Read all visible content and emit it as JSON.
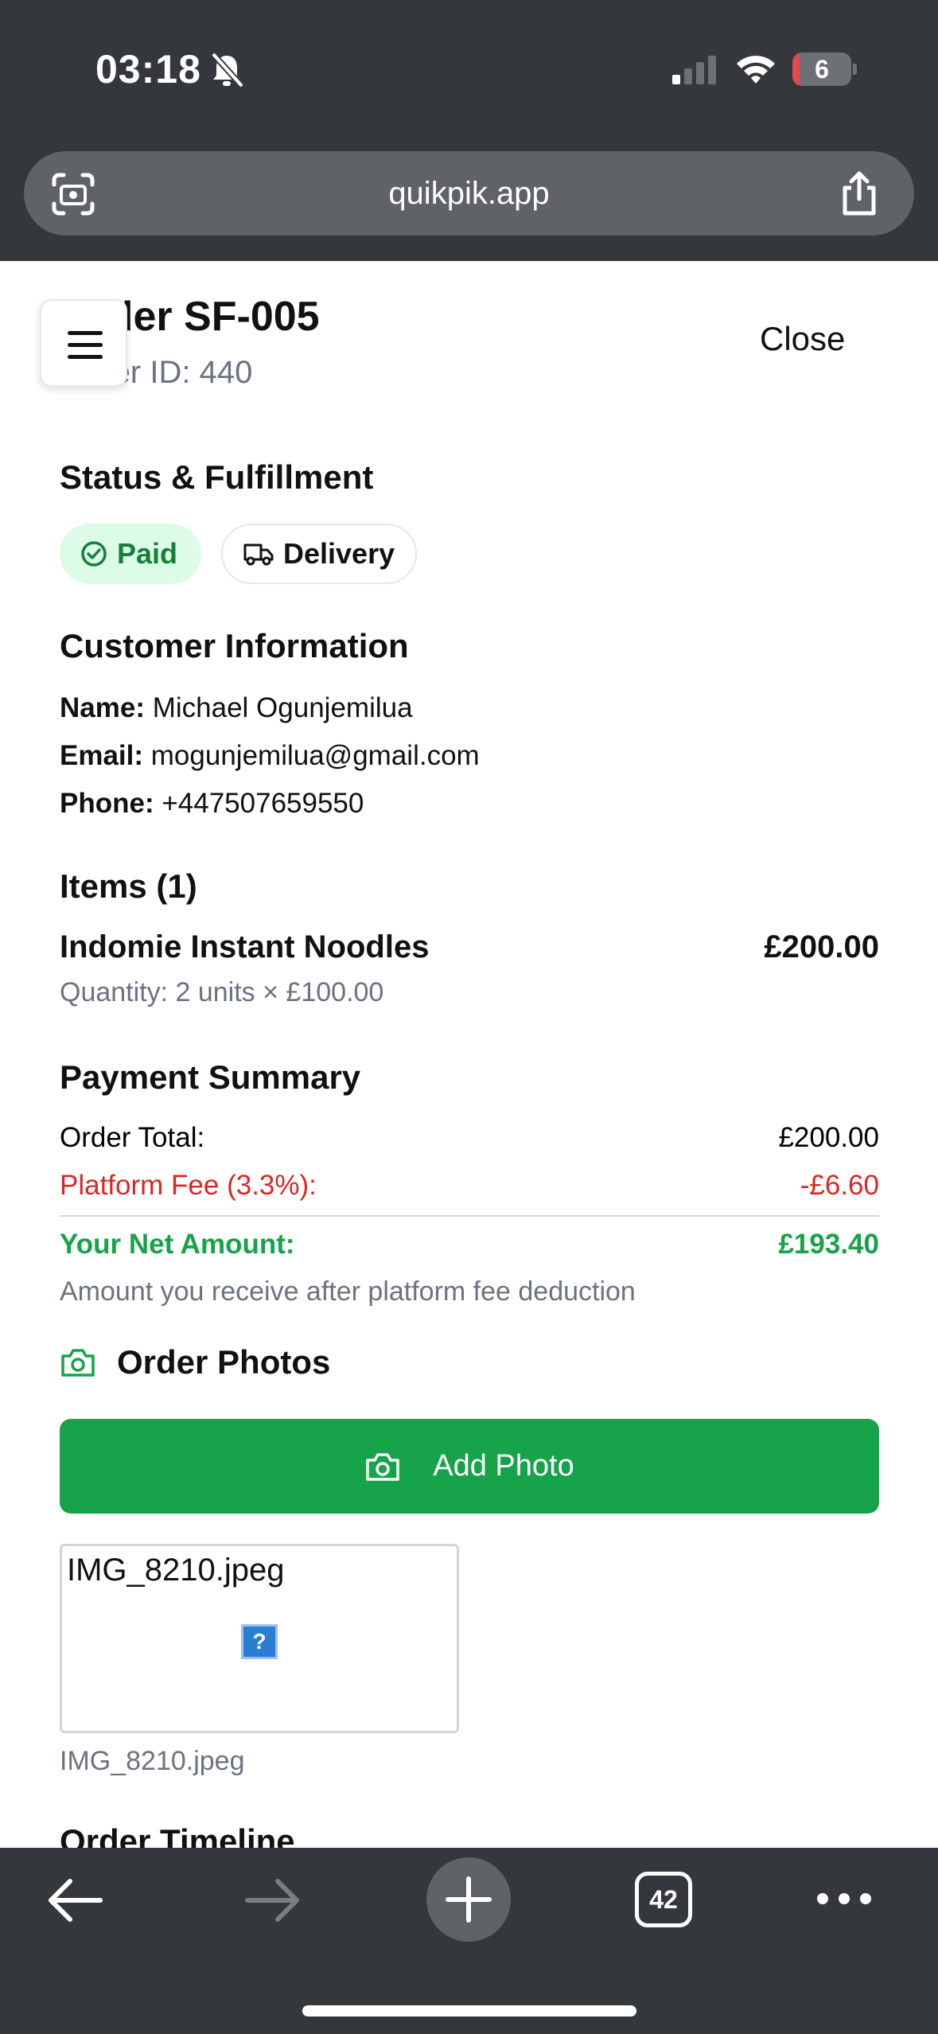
{
  "status_bar": {
    "time": "03:18",
    "battery": "6",
    "icons": [
      "bell-slash-icon",
      "cellular-signal-icon",
      "wifi-icon",
      "battery-icon"
    ]
  },
  "browser": {
    "url": "quikpik.app",
    "tab_count": "42"
  },
  "header": {
    "title": "Order SF-005",
    "order_id": "Order ID: 440",
    "close_label": "Close"
  },
  "status_section": {
    "heading": "Status & Fulfillment",
    "payment_badge": "Paid",
    "fulfillment_badge": "Delivery"
  },
  "customer": {
    "heading": "Customer Information",
    "name_label": "Name:",
    "name": "Michael Ogunjemilua",
    "email_label": "Email:",
    "email": "mogunjemilua@gmail.com",
    "phone_label": "Phone:",
    "phone": "+447507659550"
  },
  "items": {
    "heading": "Items (1)",
    "list": [
      {
        "name": "Indomie Instant Noodles",
        "price": "£200.00",
        "quantity": "Quantity: 2 units × £100.00"
      }
    ]
  },
  "payment": {
    "heading": "Payment Summary",
    "order_total_label": "Order Total:",
    "order_total": "£200.00",
    "fee_label": "Platform Fee (3.3%):",
    "fee": "-£6.60",
    "net_label": "Your Net Amount:",
    "net": "£193.40",
    "note": "Amount you receive after platform fee deduction"
  },
  "photos": {
    "heading": "Order Photos",
    "add_label": "Add Photo",
    "images": [
      {
        "alt": "IMG_8210.jpeg",
        "filename": "IMG_8210.jpeg",
        "placeholder": "?"
      }
    ]
  },
  "timeline": {
    "heading": "Order Timeline"
  },
  "colors": {
    "accent_green": "#16a34a",
    "fee_red": "#dc2626",
    "paid_badge_bg": "#dcfce7",
    "chrome_dark": "#34373b"
  }
}
